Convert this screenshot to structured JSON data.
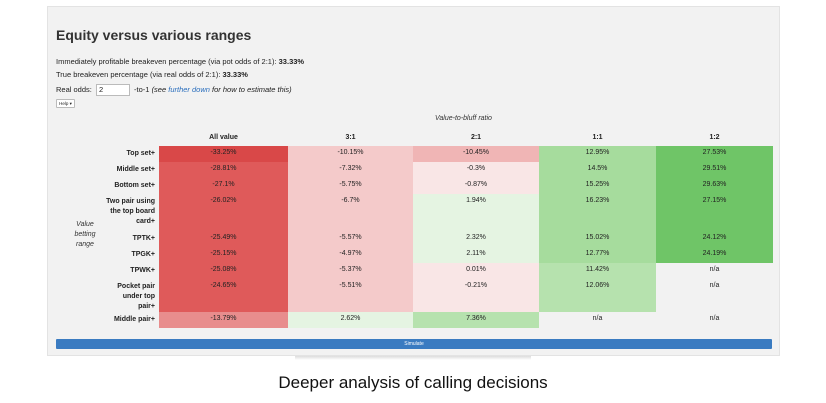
{
  "title": "Equity versus various ranges",
  "immediate_label": "Immediately profitable breakeven percentage (via pot odds of 2:1):",
  "immediate_value": "33.33%",
  "true_label": "True breakeven percentage (via real odds of 2:1):",
  "true_value": "33.33%",
  "real_odds": {
    "label": "Real odds:",
    "value": "2",
    "suffix": "-to-1",
    "note_before": "(see",
    "link": "further down",
    "note_after": "for how to estimate this)"
  },
  "help_label": "Help ▾",
  "column_group_label": "Value-to-bluff ratio",
  "row_group_label": "Value betting range",
  "columns": [
    "All value",
    "3:1",
    "2:1",
    "1:1",
    "1:2"
  ],
  "rows": [
    {
      "label": "Top set+",
      "cells": [
        "-33.25%",
        "-10.15%",
        "-10.45%",
        "12.95%",
        "27.53%"
      ]
    },
    {
      "label": "Middle set+",
      "cells": [
        "-28.81%",
        "-7.32%",
        "-0.3%",
        "14.5%",
        "29.51%"
      ]
    },
    {
      "label": "Bottom set+",
      "cells": [
        "-27.1%",
        "-5.75%",
        "-0.87%",
        "15.25%",
        "29.63%"
      ]
    },
    {
      "label": "Two pair using the top board card+",
      "cells": [
        "-26.02%",
        "-6.7%",
        "1.94%",
        "16.23%",
        "27.15%"
      ]
    },
    {
      "label": "TPTK+",
      "cells": [
        "-25.49%",
        "-5.57%",
        "2.32%",
        "15.02%",
        "24.12%"
      ]
    },
    {
      "label": "TPGK+",
      "cells": [
        "-25.15%",
        "-4.97%",
        "2.11%",
        "12.77%",
        "24.19%"
      ]
    },
    {
      "label": "TPWK+",
      "cells": [
        "-25.08%",
        "-5.37%",
        "0.01%",
        "11.42%",
        "n/a"
      ]
    },
    {
      "label": "Pocket pair under top pair+",
      "cells": [
        "-24.65%",
        "-5.51%",
        "-0.21%",
        "12.06%",
        "n/a"
      ]
    },
    {
      "label": "Middle pair+",
      "cells": [
        "-13.79%",
        "2.62%",
        "7.36%",
        "n/a",
        "n/a"
      ]
    }
  ],
  "colors": {
    "r1": "#d94848",
    "r2": "#df5a5a",
    "r3": "#e88d8d",
    "r4": "#f0b5b5",
    "r5": "#f4caca",
    "r6": "#f9e6e6",
    "g1": "#e5f4e2",
    "g2": "#b6e2ae",
    "g3": "#a6dc9d",
    "g4": "#8fd286",
    "g5": "#6fc567"
  },
  "cell_colors": [
    [
      "r1",
      "r5",
      "r4",
      "g3",
      "g5"
    ],
    [
      "r2",
      "r5",
      "r6",
      "g3",
      "g5"
    ],
    [
      "r2",
      "r5",
      "r6",
      "g3",
      "g5"
    ],
    [
      "r2",
      "r5",
      "g1",
      "g3",
      "g5"
    ],
    [
      "r2",
      "r5",
      "g1",
      "g3",
      "g5"
    ],
    [
      "r2",
      "r5",
      "g1",
      "g3",
      "g5"
    ],
    [
      "r2",
      "r5",
      "r6",
      "g2",
      null
    ],
    [
      "r2",
      "r5",
      "r6",
      "g2",
      null
    ],
    [
      "r3",
      "g1",
      "g2",
      null,
      null
    ]
  ],
  "simulate_label": "Simulate",
  "caption": "Deeper analysis of calling decisions"
}
